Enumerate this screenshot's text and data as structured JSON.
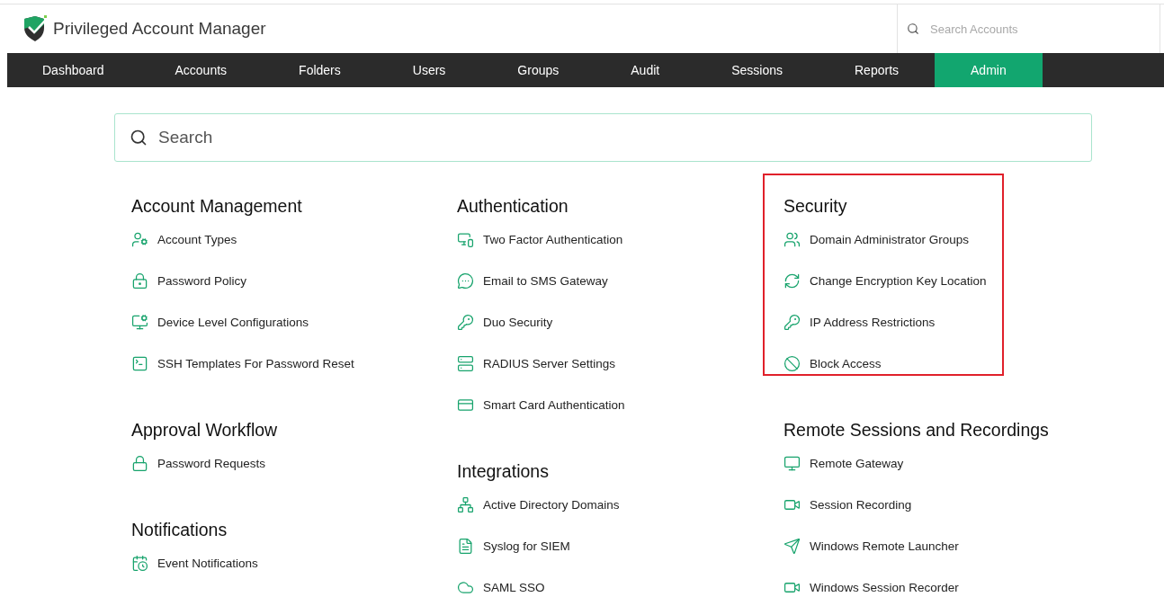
{
  "header": {
    "title": "Privileged Account Manager",
    "search_placeholder": "Search Accounts"
  },
  "nav": [
    {
      "label": "Dashboard",
      "selected": false
    },
    {
      "label": "Accounts",
      "selected": false
    },
    {
      "label": "Folders",
      "selected": false
    },
    {
      "label": "Users",
      "selected": false
    },
    {
      "label": "Groups",
      "selected": false
    },
    {
      "label": "Audit",
      "selected": false
    },
    {
      "label": "Sessions",
      "selected": false
    },
    {
      "label": "Reports",
      "selected": false
    },
    {
      "label": "Admin",
      "selected": true
    }
  ],
  "search": {
    "placeholder": "Search"
  },
  "columns": [
    [
      {
        "title": "Account Management",
        "highlighted": false,
        "items": [
          {
            "label": "Account Types"
          },
          {
            "label": "Password Policy"
          },
          {
            "label": "Device Level Configurations"
          },
          {
            "label": "SSH Templates For Password Reset"
          }
        ]
      },
      {
        "title": "Approval Workflow",
        "highlighted": false,
        "items": [
          {
            "label": "Password Requests"
          }
        ]
      },
      {
        "title": "Notifications",
        "highlighted": false,
        "items": [
          {
            "label": "Event Notifications"
          }
        ]
      }
    ],
    [
      {
        "title": "Authentication",
        "highlighted": false,
        "items": [
          {
            "label": "Two Factor Authentication"
          },
          {
            "label": "Email to SMS Gateway"
          },
          {
            "label": "Duo Security"
          },
          {
            "label": "RADIUS Server Settings"
          },
          {
            "label": "Smart Card Authentication"
          }
        ]
      },
      {
        "title": "Integrations",
        "highlighted": false,
        "items": [
          {
            "label": "Active Directory Domains"
          },
          {
            "label": "Syslog for SIEM"
          },
          {
            "label": "SAML SSO"
          }
        ]
      }
    ],
    [
      {
        "title": "Security",
        "highlighted": true,
        "items": [
          {
            "label": "Domain Administrator Groups"
          },
          {
            "label": "Change Encryption Key Location"
          },
          {
            "label": "IP Address Restrictions"
          },
          {
            "label": "Block Access"
          }
        ]
      },
      {
        "title": "Remote Sessions and Recordings",
        "highlighted": false,
        "items": [
          {
            "label": "Remote Gateway"
          },
          {
            "label": "Session Recording"
          },
          {
            "label": "Windows Remote Launcher"
          },
          {
            "label": "Windows Session Recorder"
          }
        ]
      }
    ]
  ]
}
